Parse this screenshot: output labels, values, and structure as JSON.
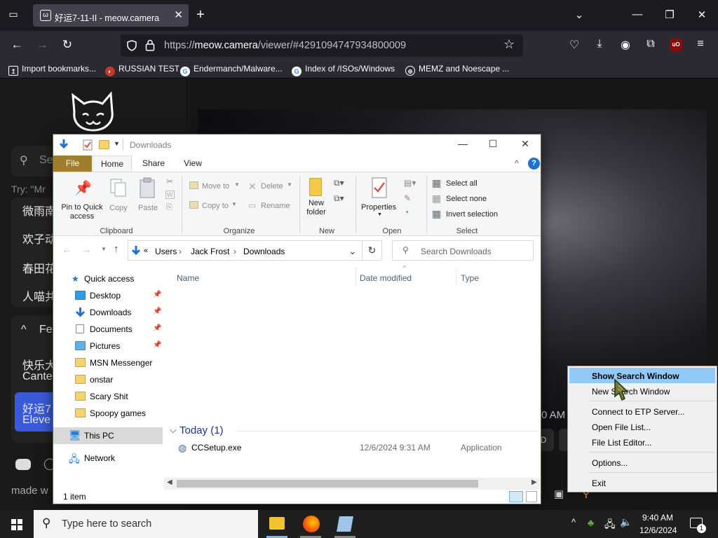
{
  "browser": {
    "tab_title": "好运7-11-II - meow.camera",
    "url_scheme": "https://",
    "url_host": "meow.camera",
    "url_path": "/viewer/#4291094747934800009",
    "bookmarks": [
      "Import bookmarks...",
      "RUSSIAN TEST",
      "Endermanch/Malware...",
      "Index of /ISOs/Windows",
      "MEMZ and Noescape ..."
    ]
  },
  "page": {
    "search_partial": "Se",
    "try_hint": "Try: \"Mr",
    "items": [
      "微雨南",
      "欢子动",
      "春田花",
      "人喵共"
    ],
    "section_label": "Fe",
    "card1_line1": "快乐大",
    "card1_line2": "Cante",
    "card2_line1": "好运7",
    "card2_line2": "Eleve",
    "time_partial": "0 AM",
    "btn_partial": "D",
    "made_with": "made w"
  },
  "explorer": {
    "title": "Downloads",
    "ribbon_tabs": [
      "File",
      "Home",
      "Share",
      "View"
    ],
    "clipboard": {
      "pin": "Pin to Quick access",
      "copy": "Copy",
      "paste": "Paste",
      "group": "Clipboard"
    },
    "organize": {
      "move_to": "Move to",
      "copy_to": "Copy to",
      "delete": "Delete",
      "rename": "Rename",
      "group": "Organize"
    },
    "new": {
      "new_folder": "New folder",
      "group": "New"
    },
    "open": {
      "properties": "Properties",
      "group": "Open"
    },
    "select": {
      "select_all": "Select all",
      "select_none": "Select none",
      "invert": "Invert selection",
      "group": "Select"
    },
    "breadcrumb": [
      "Users",
      "Jack Frost",
      "Downloads"
    ],
    "search_placeholder": "Search Downloads",
    "columns": [
      "Name",
      "Date modified",
      "Type"
    ],
    "group_header": "Today (1)",
    "files": [
      {
        "name": "CCSetup.exe",
        "date": "12/6/2024 9:31 AM",
        "type": "Application"
      }
    ],
    "nav": {
      "quick_access": "Quick access",
      "pinned": [
        "Desktop",
        "Downloads",
        "Documents",
        "Pictures"
      ],
      "folders": [
        "MSN Messenger",
        "onstar",
        "Scary Shit",
        "Spoopy games"
      ],
      "this_pc": "This PC",
      "network": "Network"
    },
    "status": "1 item"
  },
  "context_menu": {
    "items": [
      "Show Search Window",
      "New Search Window",
      "Connect to ETP Server...",
      "Open File List...",
      "File List Editor...",
      "Options...",
      "Exit"
    ]
  },
  "taskbar": {
    "search_placeholder": "Type here to search",
    "time": "9:40 AM",
    "date": "12/6/2024",
    "notification_count": "1"
  }
}
